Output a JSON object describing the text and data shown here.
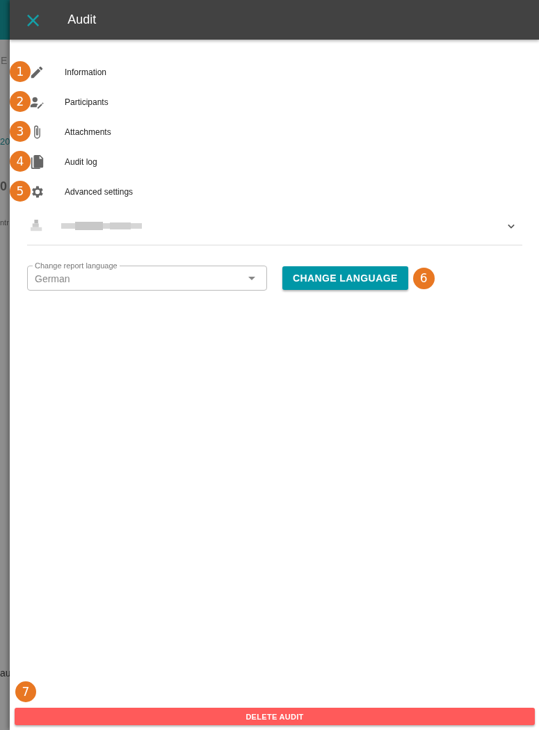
{
  "backdrop": {
    "fragments": [
      "E",
      "20",
      "0",
      "ntr",
      "au"
    ]
  },
  "header": {
    "close": "×",
    "title": "Audit"
  },
  "menu": [
    {
      "kind": "pencil",
      "label": "Information",
      "badge": "1"
    },
    {
      "kind": "person-edit",
      "label": "Participants",
      "badge": "2"
    },
    {
      "kind": "paperclip",
      "label": "Attachments",
      "badge": "3"
    },
    {
      "kind": "document",
      "label": "Audit log",
      "badge": "4"
    },
    {
      "kind": "gear",
      "label": "Advanced settings",
      "badge": "5"
    }
  ],
  "blurred_row": {
    "expanded": false
  },
  "language": {
    "label": "Change report language",
    "value": "German",
    "button": "CHANGE LANGUAGE",
    "badge": "6"
  },
  "footer": {
    "badge": "7",
    "button": "DELETE AUDIT"
  }
}
